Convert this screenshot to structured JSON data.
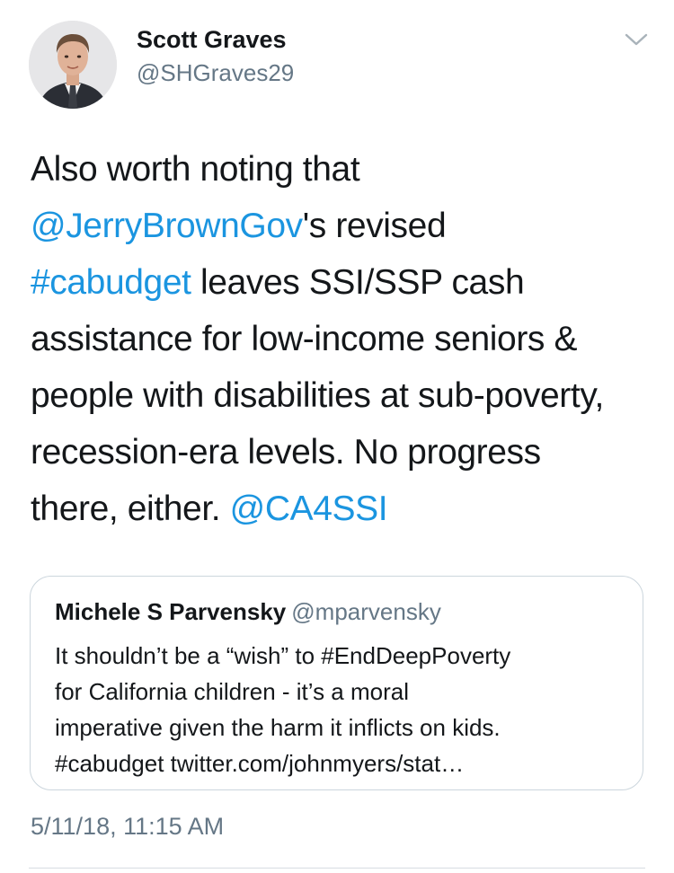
{
  "author": {
    "name": "Scott Graves",
    "handle": "@SHGraves29",
    "avatar_icon": "profile-photo"
  },
  "menu_icon": "chevron-down-icon",
  "tweet": {
    "line1": "Also worth noting that",
    "mention1": "@JerryBrownGov",
    "line2_rest": "'s revised",
    "hashtag1": "#cabudget",
    "line3_rest": " leaves SSI/SSP cash",
    "line4": "assistance for low-income seniors &",
    "line5": "people with disabilities at sub-poverty,",
    "line6": "recession-era levels. No progress",
    "line7_start": "there, either. ",
    "mention2": "@CA4SSI"
  },
  "quoted_tweet": {
    "name": "Michele S Parvensky",
    "handle": "@mparvensky",
    "line1": "It shouldn’t be a “wish” to #EndDeepPoverty",
    "line2": "for California children - it’s a moral",
    "line3": "imperative given the harm it inflicts on kids.",
    "line4": "#cabudget  twitter.com/johnmyers/stat…"
  },
  "timestamp": "5/11/18, 11:15 AM",
  "colors": {
    "link": "#1b95e0",
    "secondary_text": "#657786",
    "primary_text": "#14171a",
    "border": "#ccd6dd"
  }
}
